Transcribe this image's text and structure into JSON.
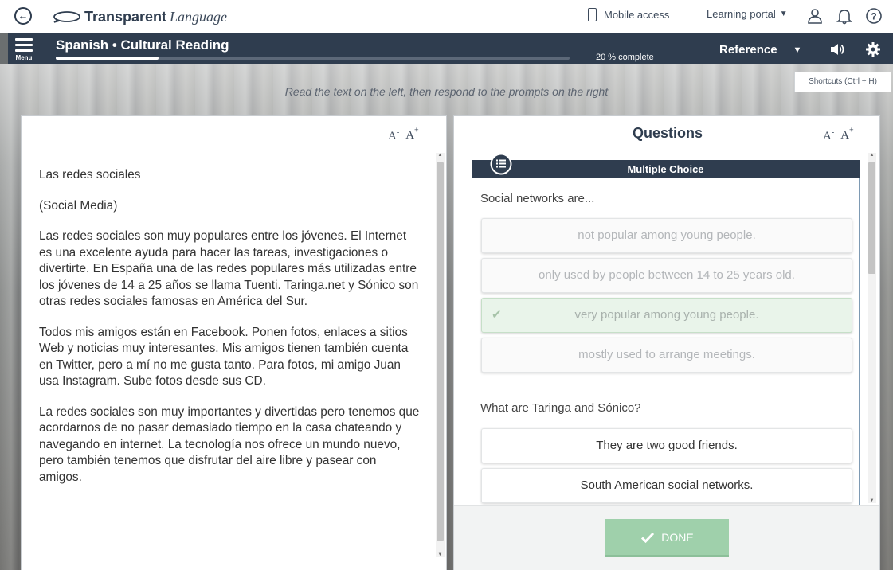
{
  "topbar": {
    "brand_bold": "Transparent",
    "brand_italic": "Language",
    "mobile_access": "Mobile access",
    "learning_portal": "Learning portal"
  },
  "navbar": {
    "menu_label": "Menu",
    "course_title": "Spanish • Cultural Reading",
    "progress_text": "20 % complete",
    "progress_value": 0.2,
    "reference_label": "Reference"
  },
  "shortcuts_label": "Shortcuts (Ctrl + H)",
  "instruction": "Read the text on the left, then respond to the prompts on the right",
  "reading": {
    "paragraphs": [
      "Las redes sociales",
      "(Social Media)",
      "Las redes sociales son muy populares entre los jóvenes. El Internet es una excelente ayuda para hacer las tareas, investigaciones o divertirte. En España una de las redes populares más utilizadas entre los jóvenes de 14 a 25 años se llama Tuenti. Taringa.net y Sónico son otras redes sociales famosas en América del Sur.",
      "Todos mis amigos están en Facebook. Ponen fotos, enlaces a sitios Web y noticias muy interesantes. Mis amigos tienen también cuenta en Twitter, pero a mí no me gusta tanto. Para fotos, mi amigo Juan usa Instagram. Sube fotos desde sus CD.",
      "La redes sociales son muy importantes y divertidas pero tenemos que acordarnos de no pasar demasiado tiempo en la casa chateando y navegando en internet. La tecnología nos ofrece un mundo nuevo, pero también tenemos que disfrutar del aire libre y pasear con amigos."
    ]
  },
  "font_controls": {
    "decrease": "A",
    "decrease_sup": "-",
    "increase": "A",
    "increase_sup": "+"
  },
  "questions": {
    "title": "Questions",
    "section_label": "Multiple Choice",
    "q1": {
      "prompt": "Social networks are...",
      "choices": [
        "not popular among young people.",
        "only used by people between 14 to 25 years old.",
        "very popular among young people.",
        "mostly used to arrange meetings."
      ],
      "selected_check": "✔"
    },
    "q2": {
      "prompt": "What are Taringa and Sónico?",
      "choices": [
        "They are two good friends.",
        "South American social networks."
      ]
    },
    "done_label": "DONE"
  },
  "colors": {
    "navy": "#2f3d4f",
    "done_green": "#9fd0ab",
    "correct_bg": "#e9f4ea"
  },
  "icons": [
    "back-icon",
    "transparent-logo-icon",
    "phone-icon",
    "user-icon",
    "bell-icon",
    "help-icon",
    "hamburger-icon",
    "speaker-icon",
    "gear-icon",
    "list-icon",
    "check-icon"
  ]
}
